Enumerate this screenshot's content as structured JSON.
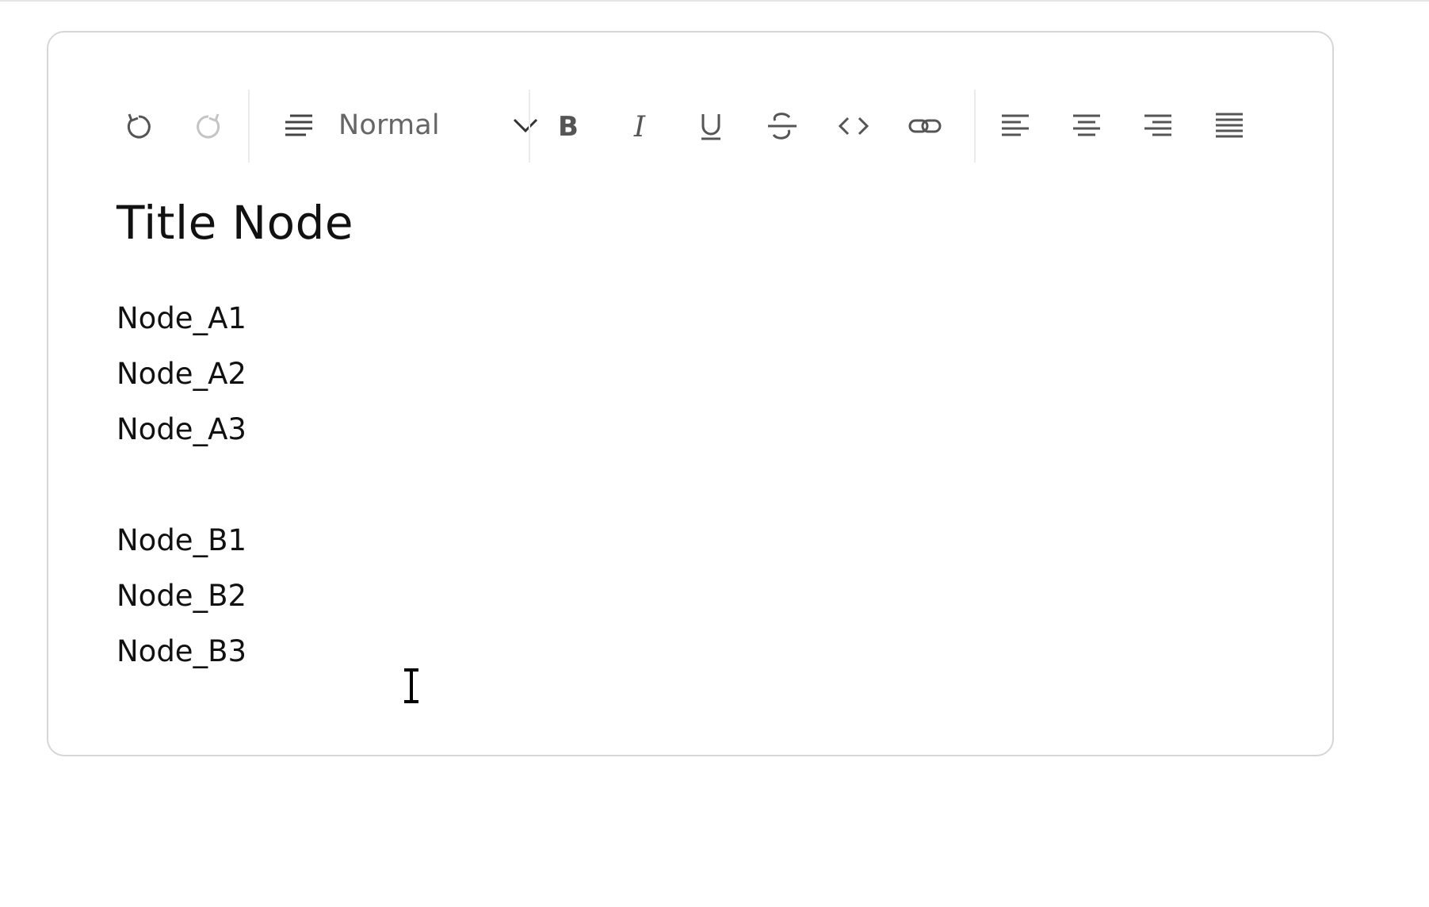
{
  "toolbar": {
    "history": [
      {
        "name": "undo",
        "icon": "undo-icon",
        "enabled": true
      },
      {
        "name": "redo",
        "icon": "redo-icon",
        "enabled": false
      }
    ],
    "block_type": {
      "icon": "paragraph-lines-icon",
      "selected": "Normal",
      "chevron_icon": "chevron-down-icon"
    },
    "format_buttons": [
      {
        "name": "bold",
        "icon": "bold-icon"
      },
      {
        "name": "italic",
        "icon": "italic-icon"
      },
      {
        "name": "underline",
        "icon": "underline-icon"
      },
      {
        "name": "strikethrough",
        "icon": "strikethrough-icon"
      },
      {
        "name": "code",
        "icon": "code-icon"
      },
      {
        "name": "link",
        "icon": "link-icon"
      }
    ],
    "align_buttons": [
      {
        "name": "align-left",
        "icon": "align-left-icon"
      },
      {
        "name": "align-center",
        "icon": "align-center-icon"
      },
      {
        "name": "align-right",
        "icon": "align-right-icon"
      },
      {
        "name": "align-justify",
        "icon": "align-justify-icon"
      }
    ]
  },
  "document": {
    "title": "Title Node",
    "group_a": [
      "Node_A1",
      "Node_A2",
      "Node_A3"
    ],
    "group_b": [
      "Node_B1",
      "Node_B2",
      "Node_B3"
    ]
  },
  "colors": {
    "icon": "#555555",
    "icon_disabled": "#c4c4c4",
    "text": "#111111",
    "border": "#d6d6d6"
  }
}
